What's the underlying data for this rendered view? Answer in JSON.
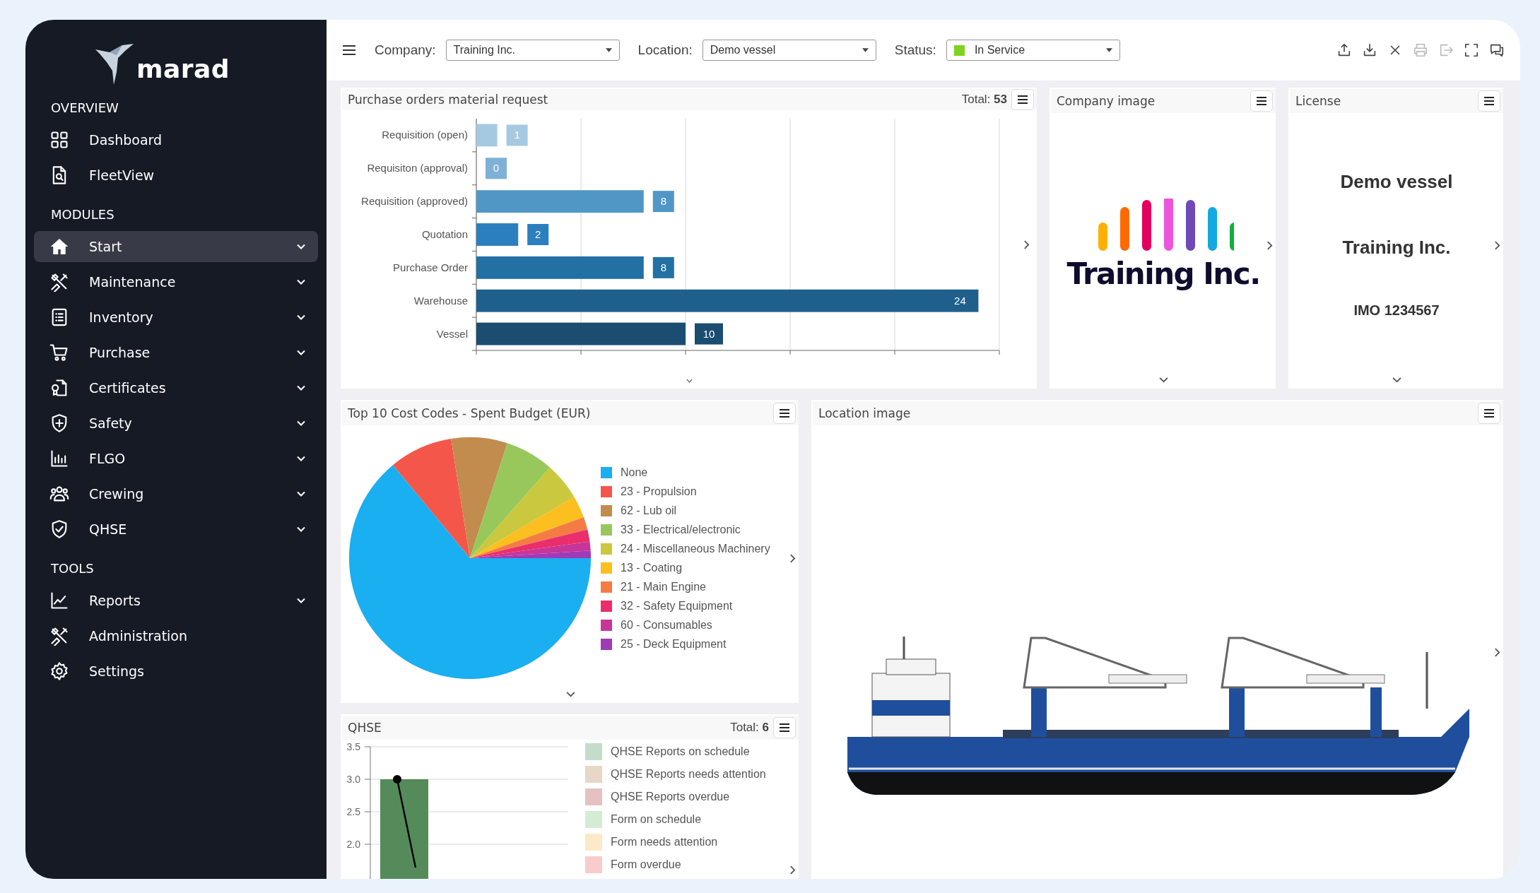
{
  "sidebar": {
    "logo": "marad",
    "sections": [
      {
        "heading": "OVERVIEW",
        "items": [
          {
            "label": "Dashboard",
            "selected": false,
            "expandable": false
          },
          {
            "label": "FleetView",
            "selected": false,
            "expandable": false
          }
        ]
      },
      {
        "heading": "MODULES",
        "items": [
          {
            "label": "Start",
            "selected": true,
            "expandable": true
          },
          {
            "label": "Maintenance",
            "selected": false,
            "expandable": true
          },
          {
            "label": "Inventory",
            "selected": false,
            "expandable": true
          },
          {
            "label": "Purchase",
            "selected": false,
            "expandable": true
          },
          {
            "label": "Certificates",
            "selected": false,
            "expandable": true
          },
          {
            "label": "Safety",
            "selected": false,
            "expandable": true
          },
          {
            "label": "FLGO",
            "selected": false,
            "expandable": true
          },
          {
            "label": "Crewing",
            "selected": false,
            "expandable": true
          },
          {
            "label": "QHSE",
            "selected": false,
            "expandable": true
          }
        ]
      },
      {
        "heading": "TOOLS",
        "items": [
          {
            "label": "Reports",
            "selected": false,
            "expandable": true
          },
          {
            "label": "Administration",
            "selected": false,
            "expandable": false
          },
          {
            "label": "Settings",
            "selected": false,
            "expandable": false
          }
        ]
      }
    ]
  },
  "toolbar": {
    "fields": [
      {
        "label": "Company:",
        "value": "Training Inc."
      },
      {
        "label": "Location:",
        "value": "Demo vessel"
      },
      {
        "label": "Status:",
        "value": "In Service",
        "color": "#7ed321"
      }
    ],
    "actions": [
      {
        "disabled": false
      },
      {
        "disabled": false
      },
      {
        "disabled": false
      },
      {
        "disabled": true
      },
      {
        "disabled": true
      },
      {
        "disabled": false
      },
      {
        "disabled": false
      }
    ]
  },
  "purchase_orders": {
    "title": "Purchase orders material request",
    "total": "Total: **53**",
    "chart_data": {
      "type": "bar",
      "orientation": "horizontal",
      "categories": [
        "Requisition (open)",
        "Requisiton (approval)",
        "Requisition (approved)",
        "Quotation",
        "Purchase Order",
        "Warehouse",
        "Vessel"
      ],
      "values": [
        1,
        0,
        8,
        2,
        8,
        24,
        10
      ],
      "xlim": [
        0,
        25
      ],
      "data_labels": true
    }
  },
  "company_image": {
    "title": "Company image",
    "logo_text": "Training Inc."
  },
  "license": {
    "title": "License",
    "lines": [
      "Demo vessel",
      "Training Inc.",
      "IMO 1234567"
    ]
  },
  "cost_codes": {
    "title": "Top 10 Cost Codes - Spent Budget (EUR)",
    "legend": [
      {
        "label": "None",
        "color": "#1aaff0"
      },
      {
        "label": "23 - Propulsion",
        "color": "#f4574a"
      },
      {
        "label": "62 - Lub oil",
        "color": "#c28c4f"
      },
      {
        "label": "33 - Electrical/electronic",
        "color": "#98c85b"
      },
      {
        "label": "24 - Miscellaneous Machinery",
        "color": "#c9c83f"
      },
      {
        "label": "13 - Coating",
        "color": "#fbbf1f"
      },
      {
        "label": "21 - Main Engine",
        "color": "#f47c44"
      },
      {
        "label": "32 - Safety Equipment",
        "color": "#ea2e6c"
      },
      {
        "label": "60 - Consumables",
        "color": "#c83598"
      },
      {
        "label": "25 - Deck Equipment",
        "color": "#9f3bb6"
      }
    ]
  },
  "location_image": {
    "title": "Location image"
  },
  "qhse": {
    "title": "QHSE",
    "total": "Total: **6**",
    "chart_data": {
      "type": "bar",
      "grid": true,
      "ylim": [
        0,
        3.5
      ],
      "yticks": [
        {
          "value": 2,
          "label": "2.0"
        },
        {
          "value": 2.5,
          "label": "2.5"
        },
        {
          "value": 3,
          "label": "3.0"
        },
        {
          "value": 3.5,
          "label": "3.5"
        }
      ],
      "values": [
        3
      ]
    },
    "legend": [
      {
        "label": "QHSE Reports on schedule",
        "color": "#c5dccb"
      },
      {
        "label": "QHSE Reports needs attention",
        "color": "#e8d6c6"
      },
      {
        "label": "QHSE Reports overdue",
        "color": "#e6c1c2"
      },
      {
        "label": "Form on schedule",
        "color": "#d4ebd4"
      },
      {
        "label": "Form needs attention",
        "color": "#fbe9c7"
      },
      {
        "label": "Form overdue",
        "color": "#f9cccc"
      }
    ]
  }
}
